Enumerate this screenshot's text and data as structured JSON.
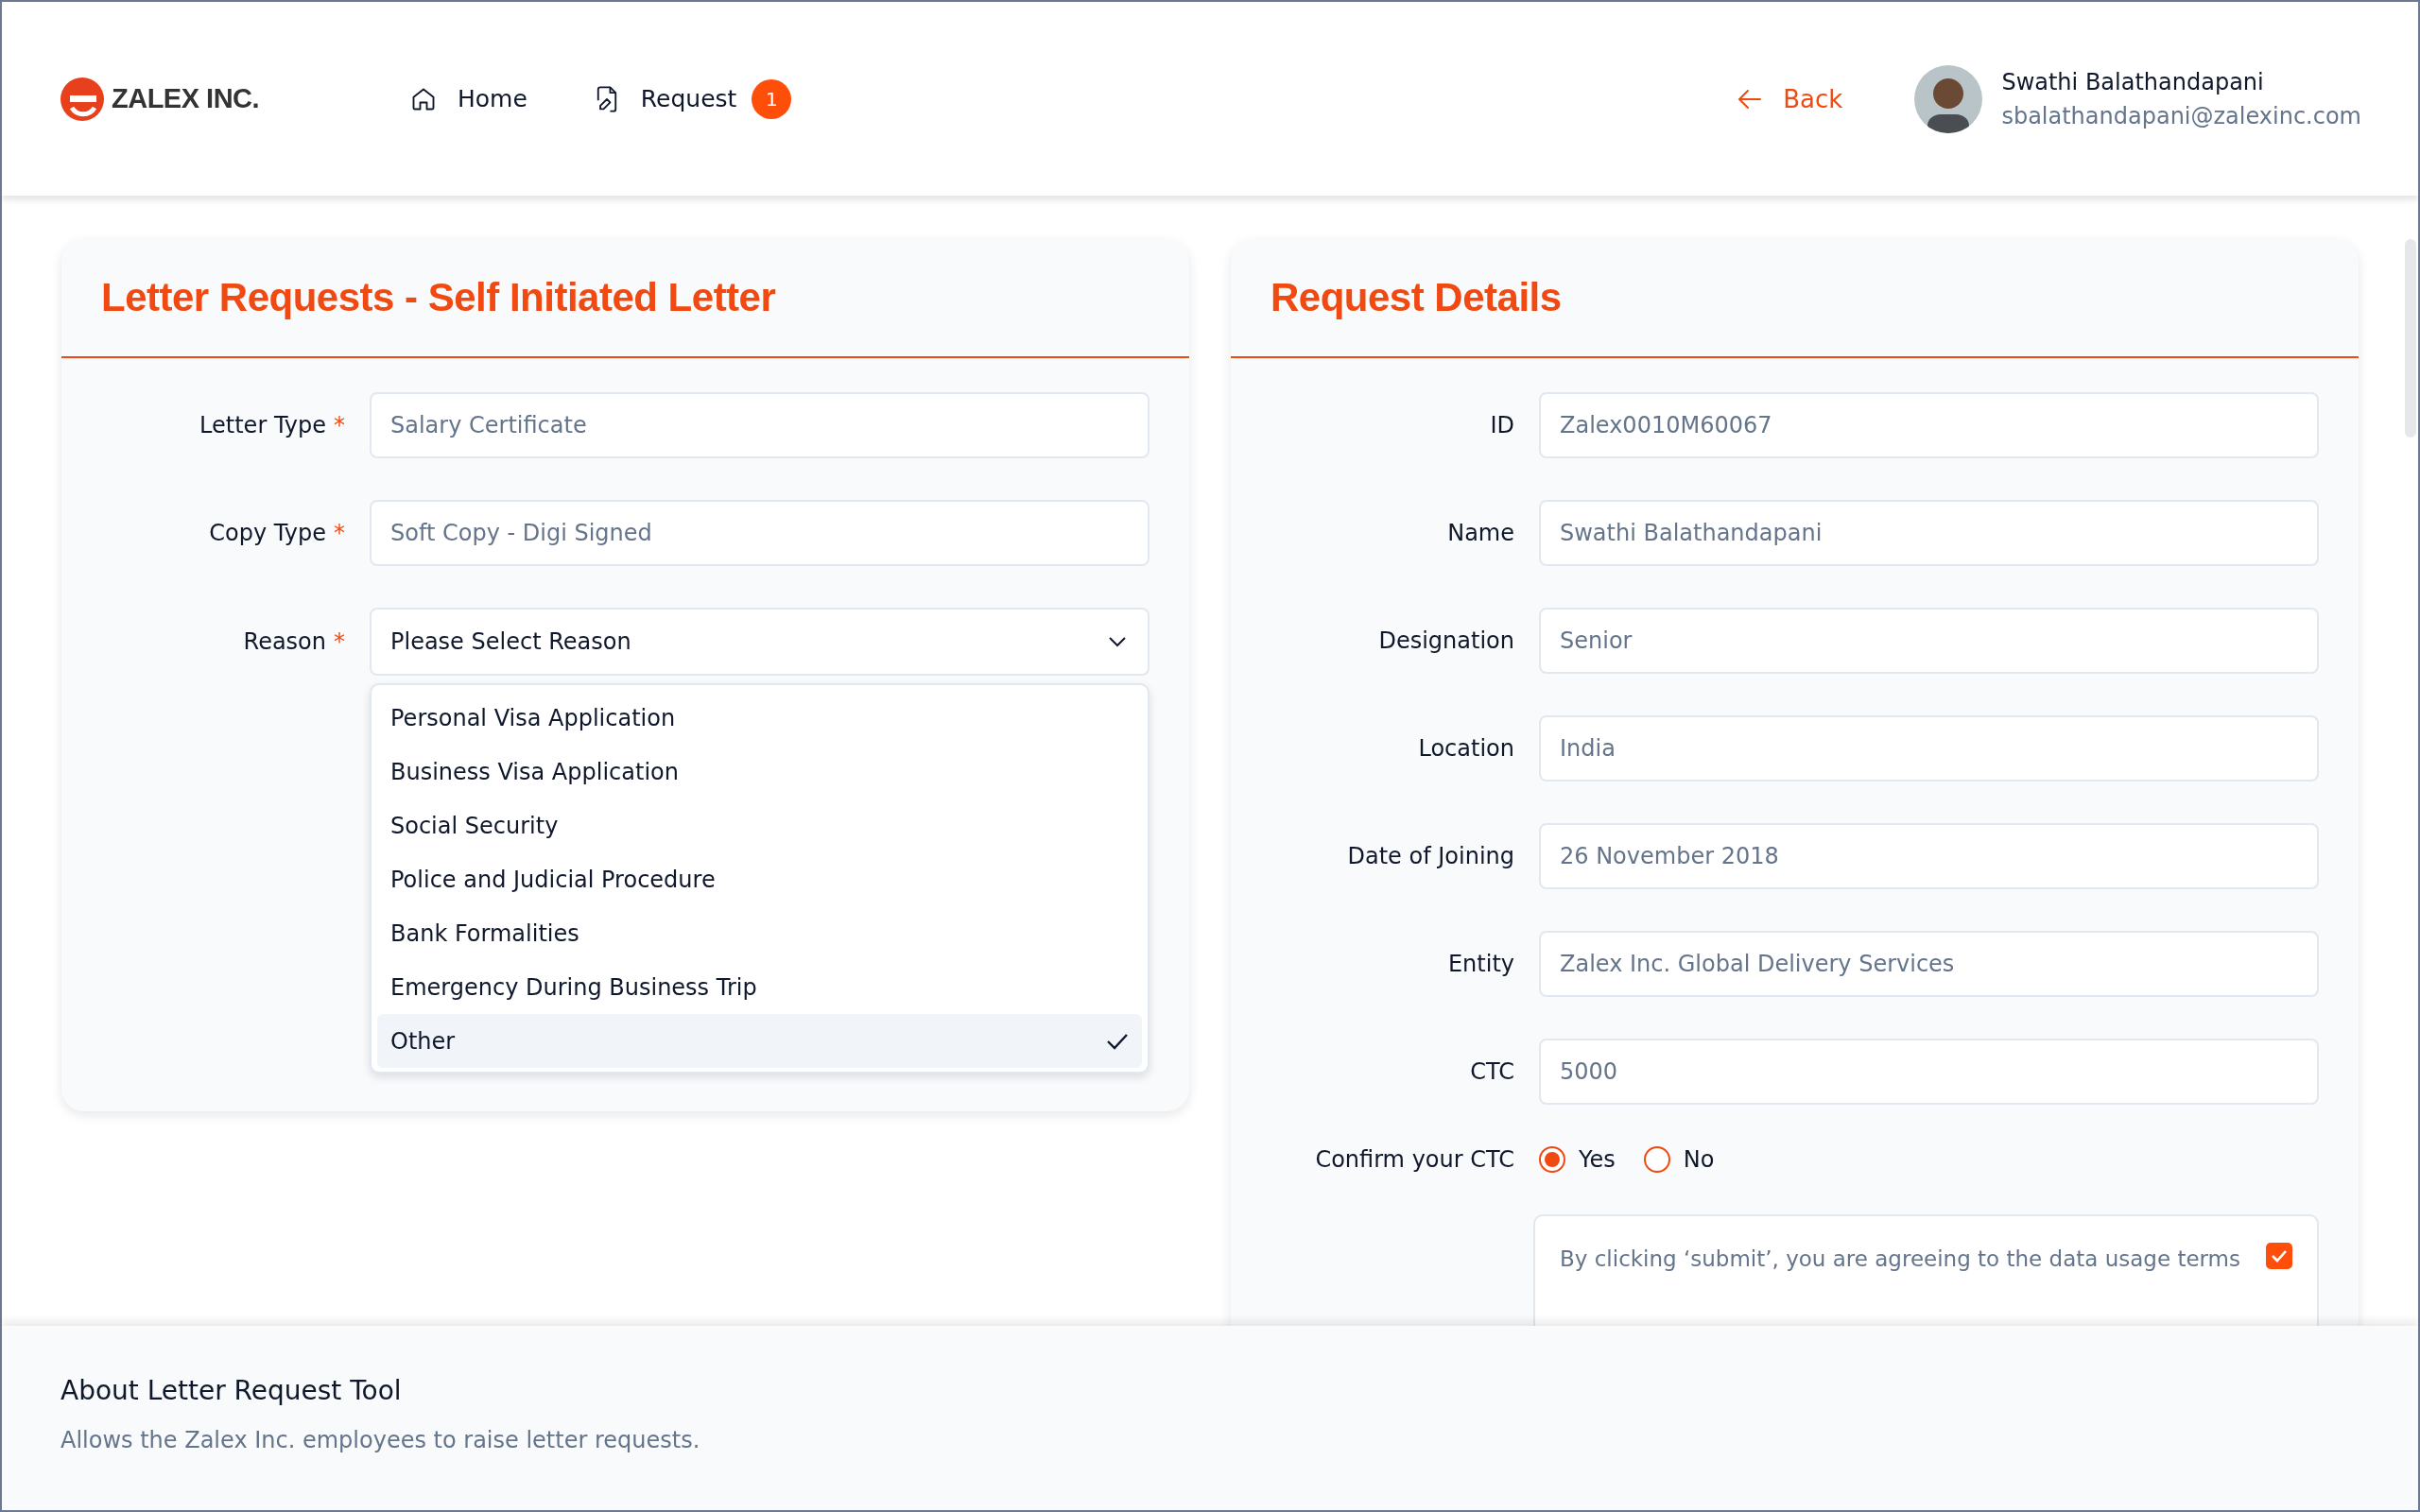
{
  "header": {
    "logo": {
      "text": "ZALEX INC."
    },
    "nav": [
      {
        "label": "Home",
        "kind": "home"
      },
      {
        "label": "Request",
        "kind": "file",
        "badge": "1"
      }
    ],
    "back": {
      "label": "Back"
    },
    "user": {
      "name": "Swathi Balathandapani",
      "email": "sbalathandapani@zalexinc.com"
    }
  },
  "letter_form": {
    "title": "Letter Requests - Self Initiated Letter",
    "fields": [
      {
        "label": "Letter Type",
        "required": "*",
        "placeholder": "Salary Certificate"
      },
      {
        "label": "Copy Type",
        "required": "*",
        "placeholder": "Soft Copy - Digi Signed"
      }
    ],
    "reason": {
      "label": "Reason",
      "required": "*",
      "value": "Please Select Reason",
      "expanded": true,
      "options": [
        {
          "label": "Personal Visa Application",
          "selected": false
        },
        {
          "label": "Business Visa Application",
          "selected": false
        },
        {
          "label": "Social Security",
          "selected": false
        },
        {
          "label": "Police and Judicial Procedure",
          "selected": false
        },
        {
          "label": "Bank Formalities",
          "selected": false
        },
        {
          "label": "Emergency During Business Trip",
          "selected": false
        },
        {
          "label": "Other",
          "selected": true
        }
      ]
    }
  },
  "details": {
    "title": "Request Details",
    "fields": [
      {
        "label": "ID",
        "value": "Zalex0010M60067"
      },
      {
        "label": "Name",
        "value": "Swathi Balathandapani"
      },
      {
        "label": "Designation",
        "value": "Senior"
      },
      {
        "label": "Location",
        "value": "India"
      },
      {
        "label": "Date of Joining",
        "value": "26 November 2018"
      },
      {
        "label": "Entity",
        "value": "Zalex Inc. Global Delivery Services"
      },
      {
        "label": "CTC",
        "value": "5000"
      }
    ],
    "confirm": {
      "label": "Confirm your CTC",
      "options": [
        {
          "label": "Yes",
          "selected": true
        },
        {
          "label": "No",
          "selected": false
        }
      ]
    },
    "consent": {
      "text": "By clicking ‘submit’, you are agreeing to the data usage terms",
      "checked": true
    }
  },
  "footer": {
    "title": "About Letter Request Tool",
    "text": "Allows the Zalex Inc. employees to raise letter requests."
  }
}
